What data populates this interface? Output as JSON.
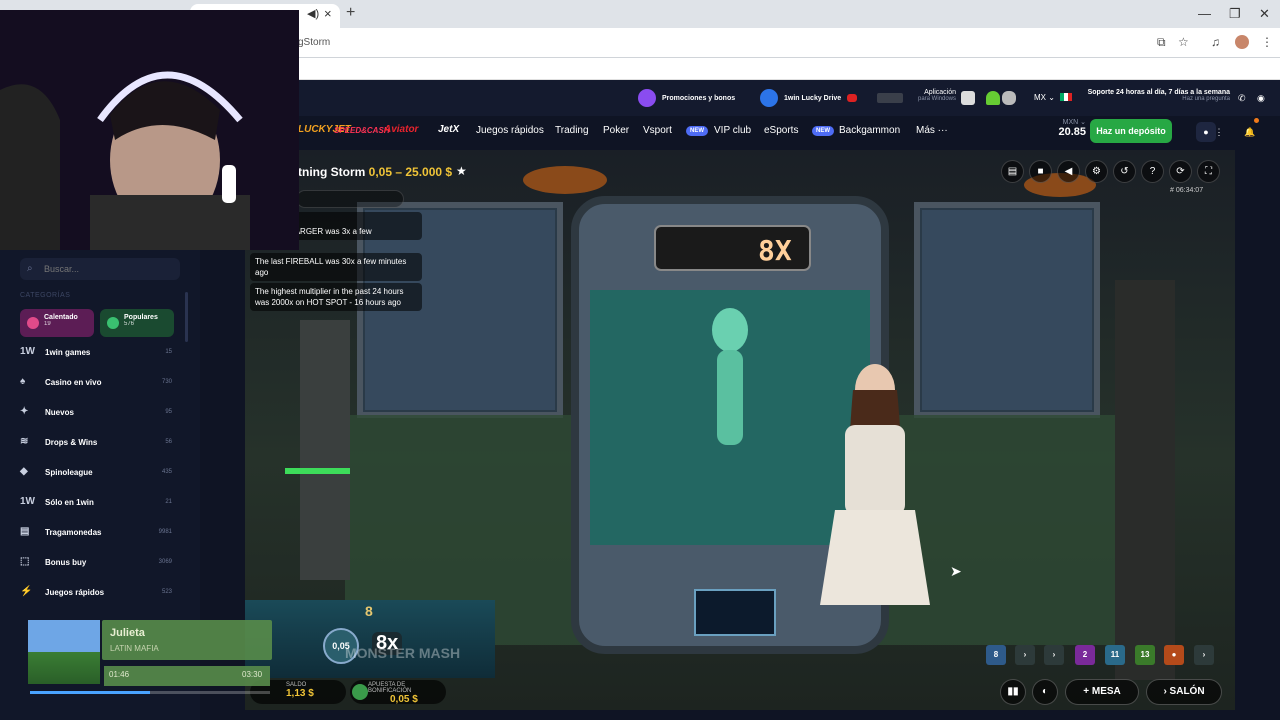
{
  "browser": {
    "url_fragment": "gStorm",
    "win_min": "—",
    "win_max": "❐",
    "win_close": "✕",
    "new_tab": "+",
    "tab_close": "×"
  },
  "topbar": {
    "promo_label": "Promociones y bonos",
    "lucky_drive": "1win Lucky Drive",
    "app_title": "Aplicación",
    "app_sub": "para Windows",
    "currency_lang": "MX ⌄",
    "support_title": "Soporte 24 horas al día, 7 días a la semana",
    "support_sub": "Haz una pregunta"
  },
  "nav": {
    "brands": [
      "LUCKYJET",
      "SPEED&CASH",
      "Aviator",
      "JetX"
    ],
    "items": [
      "Juegos rápidos",
      "Trading",
      "Poker",
      "Vsport",
      "VIP club",
      "eSports",
      "Backgammon",
      "Más ···"
    ],
    "new_badge": "NEW",
    "balance_currency": "MXN ⌄",
    "balance_amount": "20.85",
    "deposit_label": "Haz un depósito"
  },
  "sidebar": {
    "search_placeholder": "Buscar...",
    "categories_title": "CATEGORÍAS",
    "chips": [
      {
        "label": "Calentado",
        "count": "19",
        "color": "#8a2a7c"
      },
      {
        "label": "Populares",
        "count": "576",
        "color": "#1f6b3e"
      }
    ],
    "items": [
      {
        "label": "1win games",
        "count": "15",
        "icon": "1W"
      },
      {
        "label": "Casino en vivo",
        "count": "730",
        "icon": "♠"
      },
      {
        "label": "Nuevos",
        "count": "95",
        "icon": "✦"
      },
      {
        "label": "Drops & Wins",
        "count": "56",
        "icon": "≋"
      },
      {
        "label": "Spinoleague",
        "count": "435",
        "icon": "◆"
      },
      {
        "label": "Sólo en 1win",
        "count": "21",
        "icon": "1W"
      },
      {
        "label": "Tragamonedas",
        "count": "9981",
        "icon": "▤"
      },
      {
        "label": "Bonus buy",
        "count": "3069",
        "icon": "⬚"
      },
      {
        "label": "Juegos rápidos",
        "count": "523",
        "icon": "⚡"
      }
    ]
  },
  "game": {
    "title": "tning Storm",
    "limits": "0,05 – 25.000 $",
    "chat": [
      {
        "user": "r Hannah:",
        "text": "TTERY CHARGER was 3x a few"
      },
      {
        "user": "",
        "text": "The last FIREBALL was 30x a few minutes ago"
      },
      {
        "user": "",
        "text": "The highest multiplier in the past 24 hours was 2000x on HOT SPOT - 16 hours ago"
      }
    ],
    "round_id": "# 06:34:07",
    "big_multiplier": "8X",
    "hud_number": "8",
    "hud_chip": "0,05",
    "hud_multiplier": "8x",
    "hud_brand": "MONSTER MASH",
    "history": [
      {
        "v": "8",
        "color": "#2e5a8a"
      },
      {
        "v": "›",
        "color": "#2d3a3a"
      },
      {
        "v": "›",
        "color": "#2d3a3a"
      },
      {
        "v": "2",
        "color": "#7a2a9a"
      },
      {
        "v": "11",
        "color": "#2a6a8a"
      },
      {
        "v": "13",
        "color": "#3a7a2a"
      },
      {
        "v": "●",
        "color": "#b44a1a"
      },
      {
        "v": "›",
        "color": "#2d3a3a"
      }
    ],
    "balance_label": "SALDO",
    "balance_value": "1,13 $",
    "bonus_label": "APUESTA DE BONIFICACIÓN",
    "bonus_value": "0,05 $",
    "btn_mesa": "MESA",
    "btn_salon": "SALÓN"
  },
  "music": {
    "title": "Julieta",
    "artist": "LATIN MAFIA",
    "elapsed": "01:46",
    "total": "03:30",
    "progress": 0.5
  }
}
